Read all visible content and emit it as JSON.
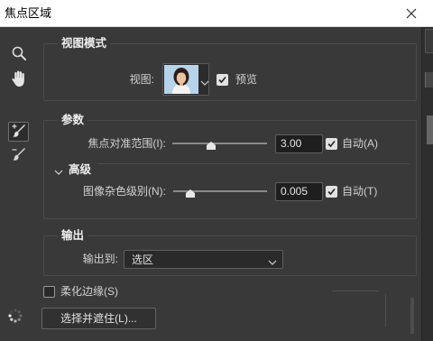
{
  "window": {
    "title": "焦点区域",
    "close_icon": "close-icon"
  },
  "toolbar": [
    {
      "icon": "zoom-icon",
      "selected": false
    },
    {
      "icon": "hand-icon",
      "selected": false
    },
    {
      "icon": "focus-area-add-icon",
      "selected": true
    },
    {
      "icon": "focus-area-subtract-icon",
      "selected": false
    }
  ],
  "view_mode": {
    "heading": "视图模式",
    "view_label": "视图:",
    "view_dropdown_icon": "chevron-down-icon",
    "preview": {
      "label": "预览",
      "checked": true
    }
  },
  "parameters": {
    "heading": "参数",
    "focus_range": {
      "label": "焦点对准范围(I):",
      "value": "3.00",
      "slider_fraction": 0.41,
      "auto": {
        "label": "自动(A)",
        "checked": true
      }
    },
    "advanced": {
      "heading": "高级",
      "expanded": true,
      "image_noise": {
        "label": "图像杂色级别(N):",
        "value": "0.005",
        "slider_fraction": 0.18,
        "auto": {
          "label": "自动(T)",
          "checked": true
        }
      }
    }
  },
  "output": {
    "heading": "输出",
    "output_to_label": "输出到:",
    "selected": "选区"
  },
  "soften_edge": {
    "label": "柔化边缘(S)",
    "checked": false
  },
  "select_and_mask_button": "选择并遮住(L)...",
  "status": {
    "busy_icon": "spinner-icon"
  }
}
